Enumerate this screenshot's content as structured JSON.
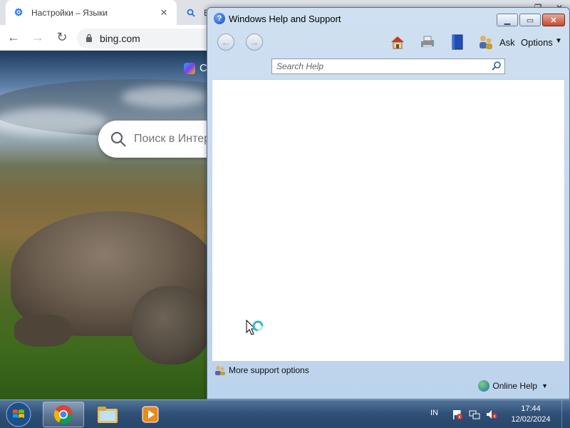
{
  "browser": {
    "tabs": [
      {
        "label": "Настройки – Языки",
        "close": "✕"
      },
      {
        "label": "В"
      }
    ],
    "url": "bing.com",
    "page": {
      "copilot_text": "C",
      "search_placeholder": "Поиск в Интер"
    }
  },
  "help_window": {
    "title": "Windows Help and Support",
    "toolbar": {
      "ask_label": "Ask",
      "options_label": "Options"
    },
    "search_placeholder": "Search Help",
    "more_support_label": "More support options",
    "online_help_label": "Online Help"
  },
  "taskbar": {
    "language": "IN",
    "time": "17:44",
    "date": "12/02/2024"
  }
}
